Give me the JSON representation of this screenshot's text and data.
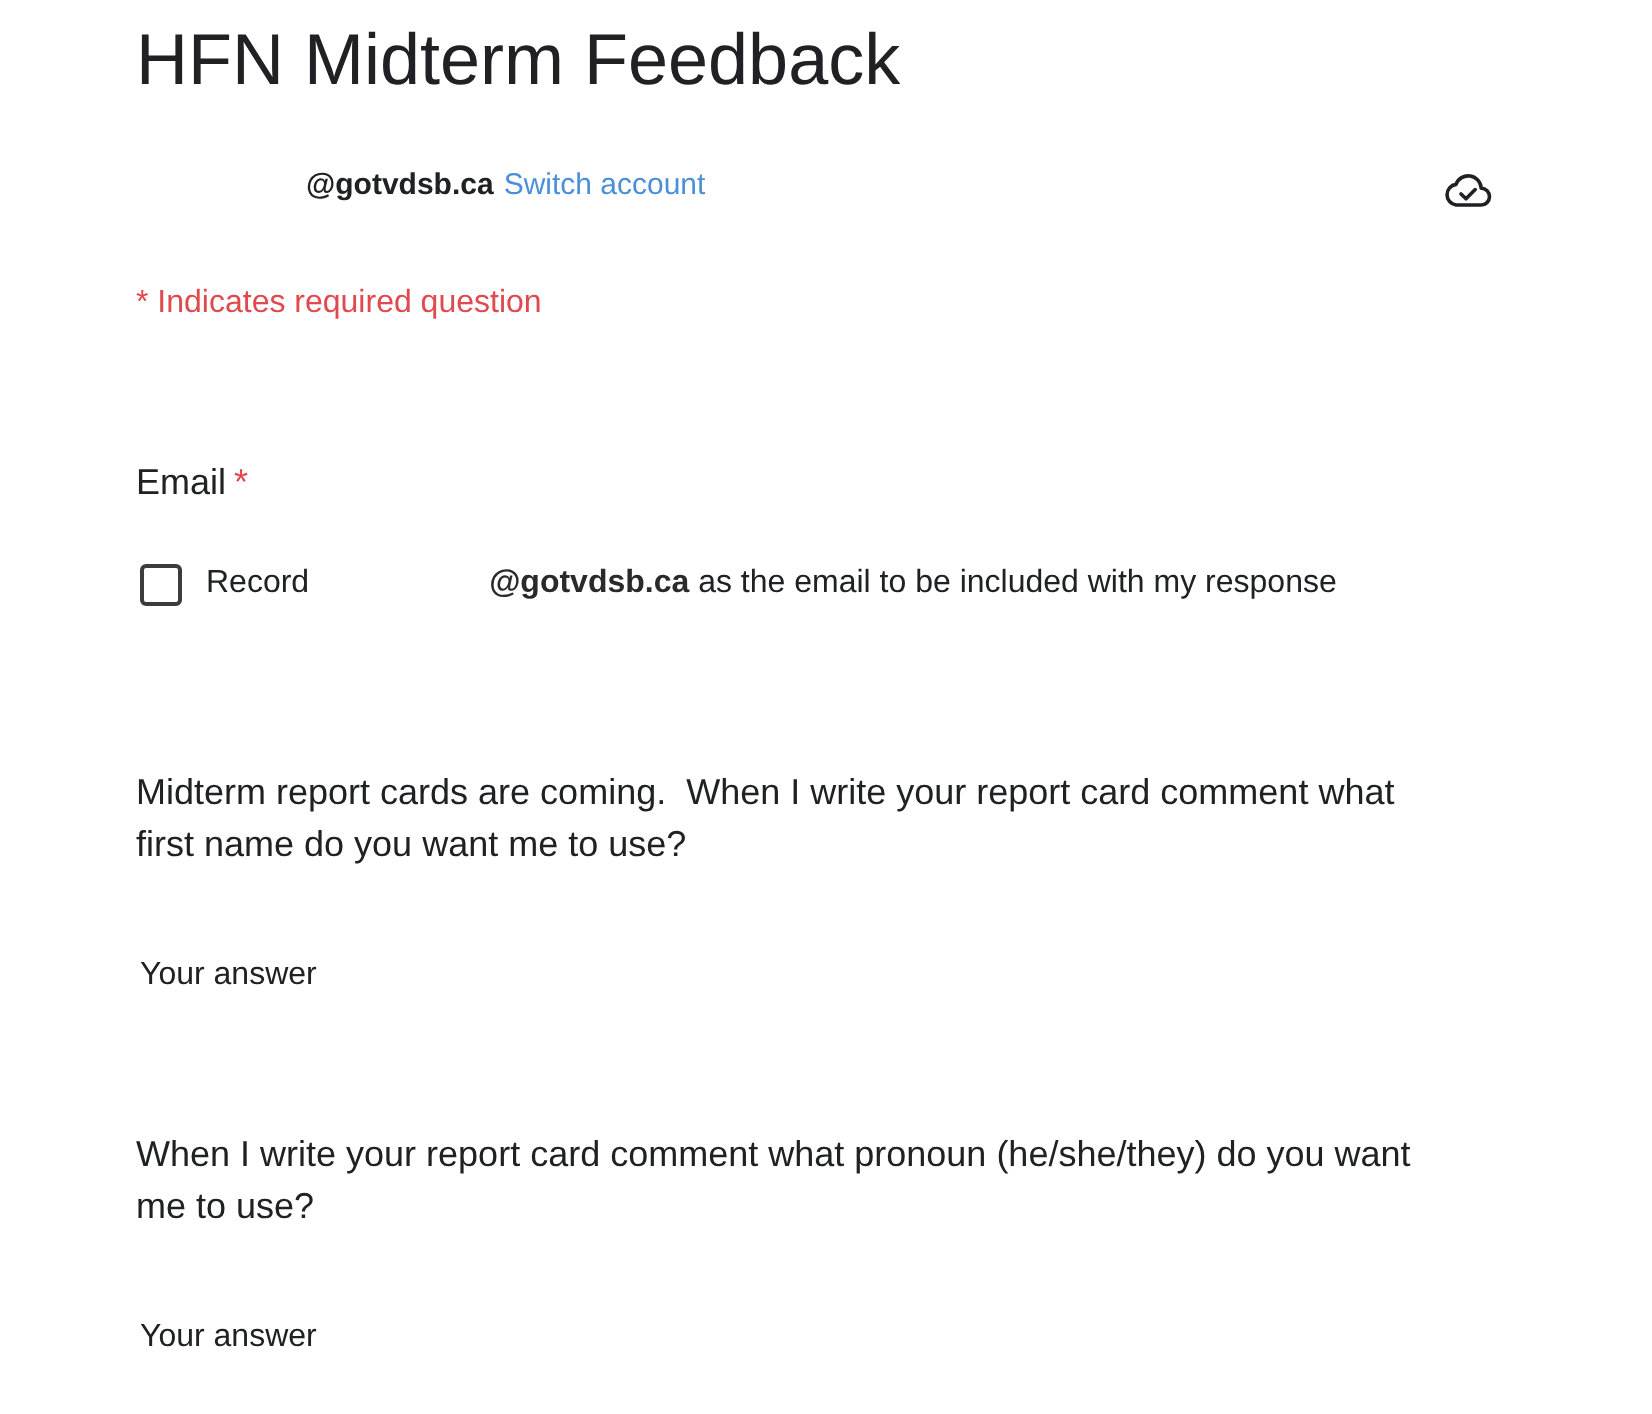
{
  "form": {
    "title": "HFN Midterm Feedback"
  },
  "account": {
    "email": "@gotvdsb.ca",
    "switch_link": "Switch account"
  },
  "required_note": "* Indicates required question",
  "questions": [
    {
      "kind": "email",
      "title": "Email",
      "required_mark": "*",
      "option": {
        "checked": false,
        "label_start": "Record",
        "label_end": "**@gotvdsb.ca** as the email to be included with my response"
      }
    },
    {
      "kind": "short_answer",
      "title": "Midterm report cards are coming.  When I write your report card comment what first name do you want me to use?",
      "placeholder": "Your answer"
    },
    {
      "kind": "short_answer",
      "title": "When I write your report card comment what pronoun (he/she/they) do you want me to use?",
      "placeholder": "Your answer"
    }
  ]
}
